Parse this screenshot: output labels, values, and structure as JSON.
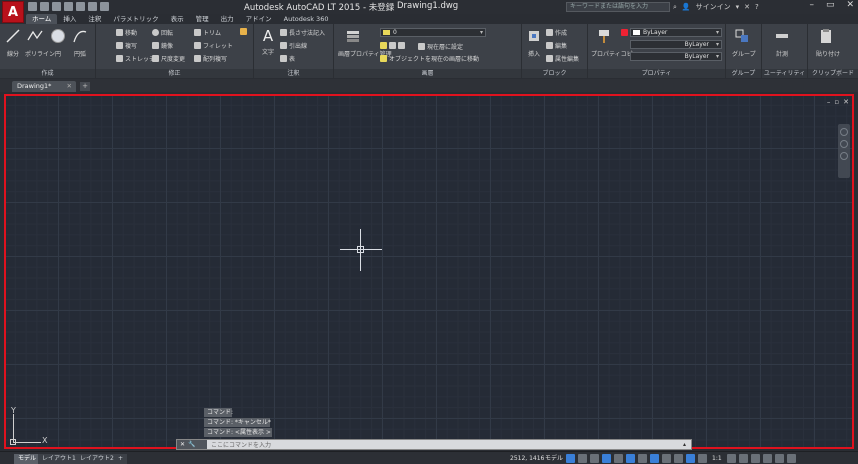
{
  "app": {
    "logo_letter": "A",
    "title": "Autodesk AutoCAD LT 2015 - 未登録",
    "file_name": "Drawing1.dwg",
    "search_placeholder": "キーワードまたは語句を入力",
    "signin_label": "サインイン"
  },
  "ribbon_tabs": [
    "ホーム",
    "挿入",
    "注釈",
    "パラメトリック",
    "表示",
    "管理",
    "出力",
    "アドイン",
    "Autodesk 360"
  ],
  "ribbon": {
    "draw": {
      "label": "作成",
      "line": "線分",
      "polyline": "ポリライン",
      "circle": "円",
      "arc": "円弧"
    },
    "modify": {
      "label": "修正",
      "move": "移動",
      "copy": "複写",
      "stretch": "ストレッチ",
      "rotate": "回転",
      "mirror": "鏡像",
      "scale": "尺度変更",
      "trim": "トリム",
      "fillet": "フィレット",
      "array": "配列複写"
    },
    "annotation": {
      "label": "注釈",
      "text": "文字",
      "dimension": "長さ寸法記入",
      "leader": "引出線",
      "table": "表"
    },
    "layers": {
      "label": "画層",
      "properties": "画層プロパティ管理",
      "layer_name": "0",
      "make_current": "現在層に設定",
      "match": "オブジェクトを現在の画層に移動"
    },
    "block": {
      "label": "ブロック",
      "insert": "挿入",
      "create": "作成",
      "edit": "編集",
      "attribute": "属性編集"
    },
    "properties": {
      "label": "プロパティ",
      "match": "プロパティコピー",
      "color": "ByLayer",
      "linetype": "ByLayer",
      "lineweight": "ByLayer"
    },
    "groups": {
      "label": "グループ",
      "group": "グループ"
    },
    "utilities": {
      "label": "ユーティリティ",
      "measure": "計測"
    },
    "clipboard": {
      "label": "クリップボード",
      "paste": "貼り付け"
    }
  },
  "doc_tab": {
    "name": "Drawing1*"
  },
  "command": {
    "history": [
      "コマンド:",
      "コマンド: *キャンセル*",
      "コマンド: <属性表示 >"
    ],
    "placeholder": "ここにコマンドを入力"
  },
  "ucs": {
    "x": "X",
    "y": "Y"
  },
  "status": {
    "layout_tabs": [
      "モデル",
      "レイアウト1",
      "レイアウト2"
    ],
    "coords": "2512, 1416",
    "mode": "モデル",
    "annotation_scale": "1:1"
  },
  "colors": {
    "canvas_bg": "#252b36",
    "highlight_border": "#e0121e",
    "accent": "#3a7fd8"
  }
}
